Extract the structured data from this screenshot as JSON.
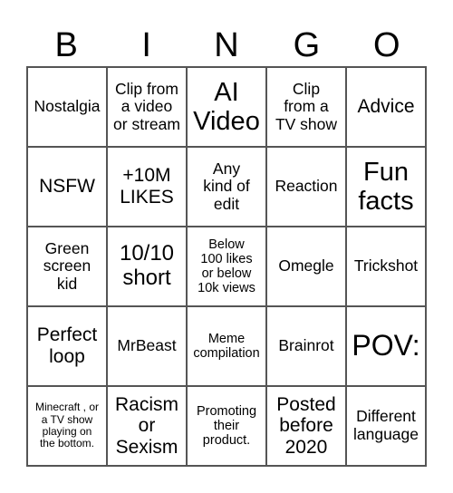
{
  "header": {
    "letters": [
      "B",
      "I",
      "N",
      "G",
      "O"
    ]
  },
  "cells": [
    {
      "text": "Nostalgia",
      "size": "s-md"
    },
    {
      "text": "Clip from\na video\nor stream",
      "size": "s-md"
    },
    {
      "text": "AI\nVideo",
      "size": "s-xxl"
    },
    {
      "text": "Clip\nfrom a\nTV show",
      "size": "s-md"
    },
    {
      "text": "Advice",
      "size": "s-lg"
    },
    {
      "text": "NSFW",
      "size": "s-lg"
    },
    {
      "text": "+10M\nLIKES",
      "size": "s-lg"
    },
    {
      "text": "Any\nkind of\nedit",
      "size": "s-md"
    },
    {
      "text": "Reaction",
      "size": "s-md"
    },
    {
      "text": "Fun\nfacts",
      "size": "s-xxl"
    },
    {
      "text": "Green\nscreen\nkid",
      "size": "s-md"
    },
    {
      "text": "10/10\nshort",
      "size": "s-xl"
    },
    {
      "text": "Below\n100 likes\nor below\n10k views",
      "size": "s-sm"
    },
    {
      "text": "Omegle",
      "size": "s-md"
    },
    {
      "text": "Trickshot",
      "size": "s-md"
    },
    {
      "text": "Perfect\nloop",
      "size": "s-lg"
    },
    {
      "text": "MrBeast",
      "size": "s-md"
    },
    {
      "text": "Meme\ncompilation",
      "size": "s-sm"
    },
    {
      "text": "Brainrot",
      "size": "s-md"
    },
    {
      "text": "POV:",
      "size": "s-xxxl"
    },
    {
      "text": "Minecraft , or\na TV show\nplaying on\nthe bottom.",
      "size": "s-xs"
    },
    {
      "text": "Racism\nor\nSexism",
      "size": "s-lg"
    },
    {
      "text": "Promoting\ntheir\nproduct.",
      "size": "s-sm"
    },
    {
      "text": "Posted\nbefore\n2020",
      "size": "s-lg"
    },
    {
      "text": "Different\nlanguage",
      "size": "s-md"
    }
  ]
}
